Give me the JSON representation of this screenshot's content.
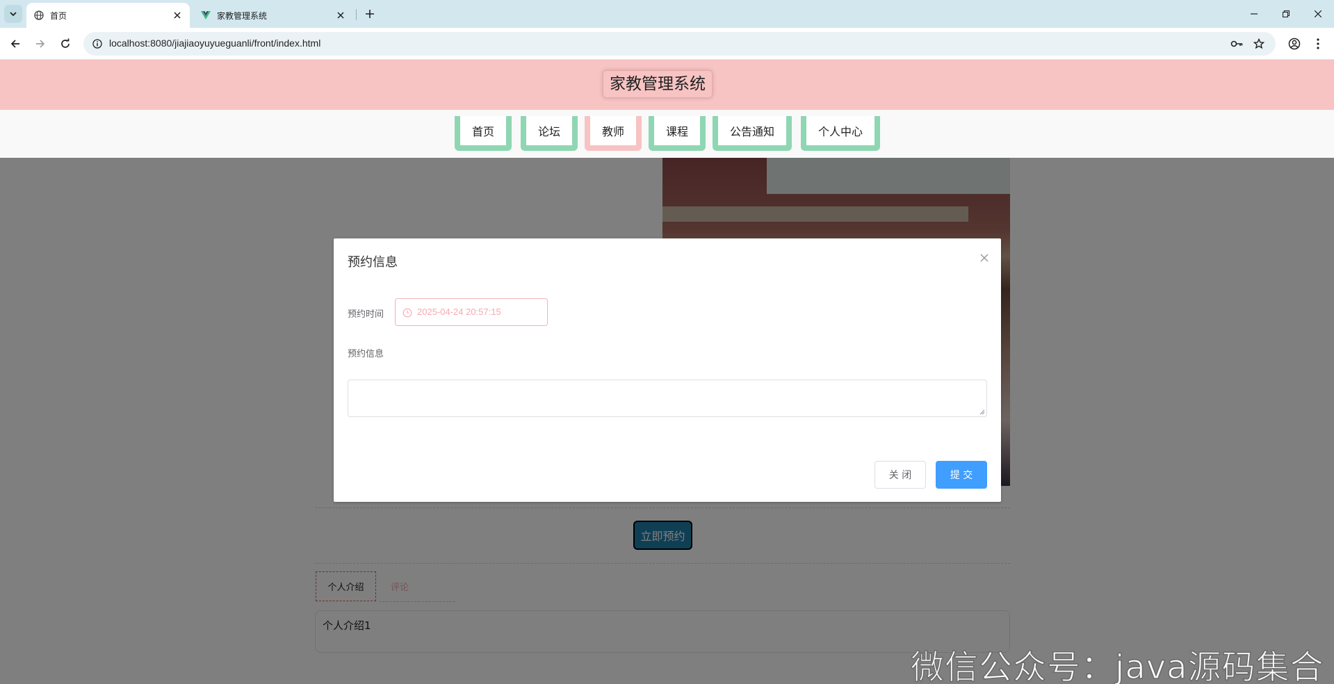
{
  "browser": {
    "tabs": [
      {
        "title": "首页",
        "icon": "globe-icon"
      },
      {
        "title": "家教管理系统",
        "icon": "vue-logo-icon"
      }
    ],
    "url": "localhost:8080/jiajiaoyuyueguanli/front/index.html"
  },
  "site": {
    "title": "家教管理系统",
    "nav": [
      "首页",
      "论坛",
      "教师",
      "课程",
      "公告通知",
      "个人中心"
    ],
    "active_nav": "教师",
    "colors": {
      "header": "#f7c3c3",
      "nav_border": "#8fd6b3",
      "book_button": "#1f7ea8"
    }
  },
  "teacher": {
    "book_button": "立即预约",
    "tabs": [
      "个人介绍",
      "评论"
    ],
    "intro": "个人介绍1"
  },
  "dialog": {
    "title": "预约信息",
    "time_label": "预约时间",
    "time_value": "2025-04-24 20:57:15",
    "info_label": "预约信息",
    "info_value": "",
    "close_button": "关 闭",
    "submit_button": "提 交",
    "submit_color": "#409eff"
  },
  "watermark": "微信公众号：java源码集合"
}
